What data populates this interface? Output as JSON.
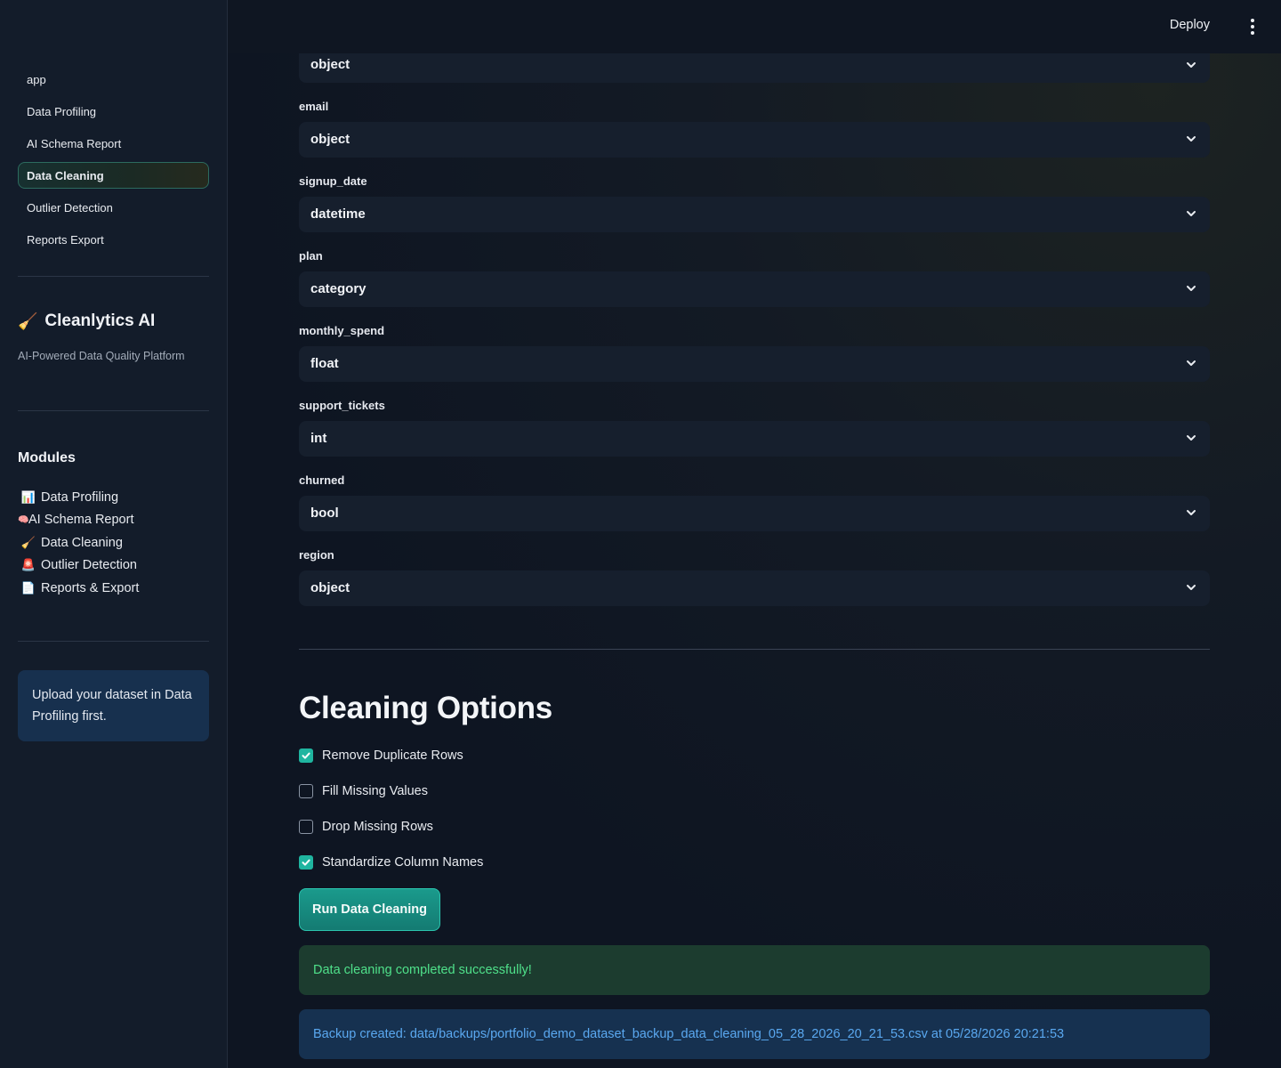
{
  "sidebar": {
    "nav": [
      {
        "label": "app",
        "active": false
      },
      {
        "label": "Data Profiling",
        "active": false
      },
      {
        "label": "AI Schema Report",
        "active": false
      },
      {
        "label": "Data Cleaning",
        "active": true
      },
      {
        "label": "Outlier Detection",
        "active": false
      },
      {
        "label": "Reports Export",
        "active": false
      }
    ],
    "brand": {
      "icon": "broom-icon",
      "glyph": "🧹",
      "name": "Cleanlytics AI"
    },
    "tagline": "AI-Powered Data Quality Platform",
    "modules_title": "Modules",
    "modules": [
      {
        "icon": "bar-chart-icon",
        "glyph": "📊",
        "label": "Data Profiling"
      },
      {
        "icon": "brain-icon",
        "glyph": "🧠",
        "label": "AI Schema Report"
      },
      {
        "icon": "broom-icon",
        "glyph": "🧹",
        "label": "Data Cleaning"
      },
      {
        "icon": "siren-icon",
        "glyph": "🚨",
        "label": "Outlier Detection"
      },
      {
        "icon": "document-icon",
        "glyph": "📄",
        "label": "Reports & Export"
      }
    ],
    "info_box": "Upload your dataset in Data Profiling first."
  },
  "header": {
    "deploy_label": "Deploy",
    "menu_icon": "kebab-menu-icon"
  },
  "main": {
    "top_select_value": "object",
    "columns": [
      {
        "name": "email",
        "type": "object"
      },
      {
        "name": "signup_date",
        "type": "datetime"
      },
      {
        "name": "plan",
        "type": "category"
      },
      {
        "name": "monthly_spend",
        "type": "float"
      },
      {
        "name": "support_tickets",
        "type": "int"
      },
      {
        "name": "churned",
        "type": "bool"
      },
      {
        "name": "region",
        "type": "object"
      }
    ],
    "cleaning_title": "Cleaning Options",
    "options": [
      {
        "label": "Remove Duplicate Rows",
        "checked": true
      },
      {
        "label": "Fill Missing Values",
        "checked": false
      },
      {
        "label": "Drop Missing Rows",
        "checked": false
      },
      {
        "label": "Standardize Column Names",
        "checked": true
      }
    ],
    "run_button": "Run Data Cleaning",
    "success_message": "Data cleaning completed successfully!",
    "backup_message": "Backup created: data/backups/portfolio_demo_dataset_backup_data_cleaning_05_28_2026_20_21_53.csv at 05/28/2026 20:21:53"
  },
  "colors": {
    "accent": "#1fb5a0",
    "success_bg": "#1c3c2f",
    "success_text": "#4fe08a",
    "info_bg": "#163150",
    "info_text": "#5aa8f0"
  }
}
